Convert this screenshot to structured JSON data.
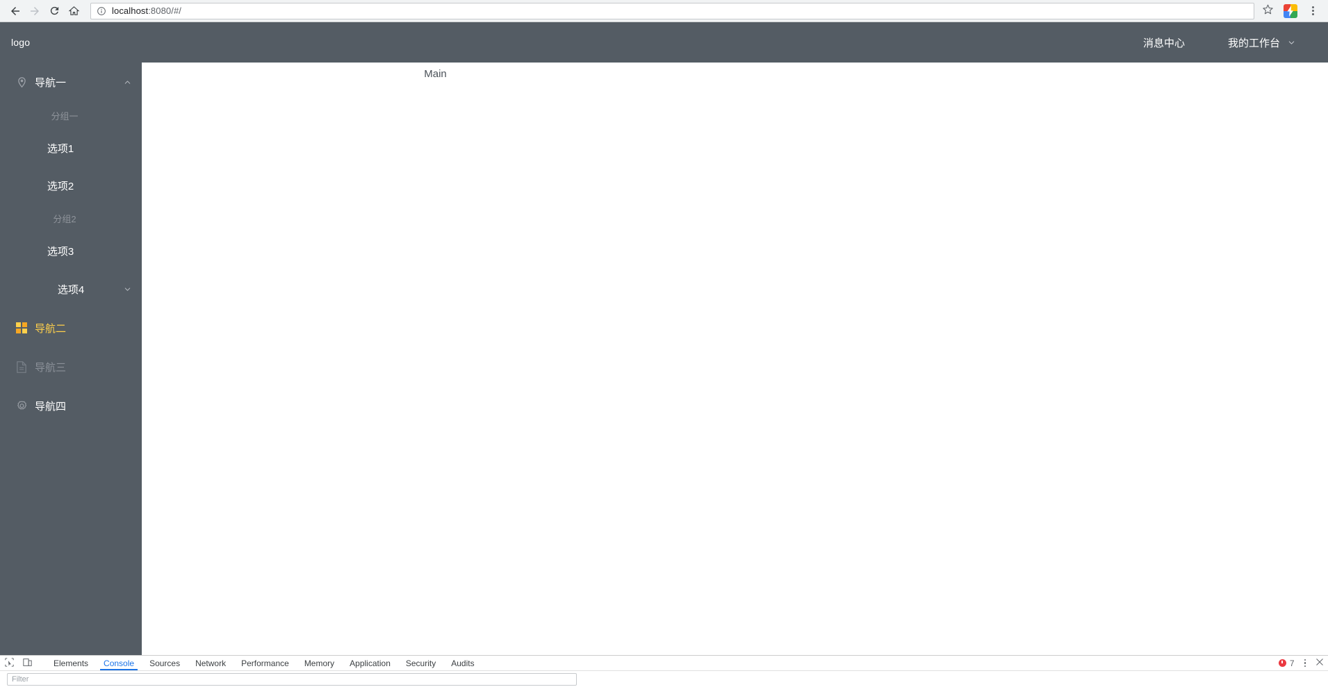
{
  "browser": {
    "back_icon": "back-arrow-icon",
    "forward_icon": "forward-arrow-icon",
    "reload_icon": "reload-icon",
    "home_icon": "home-icon",
    "info_icon": "page-info-icon",
    "url_host": "localhost",
    "url_rest": ":8080/#/",
    "url_full": "localhost:8080/#/",
    "star_icon": "bookmark-star-icon",
    "extension_icon": "extension-icon",
    "menu_icon": "browser-menu-icon"
  },
  "header": {
    "logo": "logo",
    "items": [
      {
        "label": "消息中心",
        "has_chevron": false
      },
      {
        "label": "我的工作台",
        "has_chevron": true
      }
    ]
  },
  "sidebar": {
    "bg_color": "#545c64",
    "active_color": "#ffd04b",
    "disabled_color": "#8b9199",
    "items": [
      {
        "label": "导航一",
        "icon": "location-pin-icon",
        "arrow": "chevron-up-icon",
        "state": "expanded",
        "groups": [
          {
            "title": "分组一",
            "children": [
              {
                "label": "选项1"
              },
              {
                "label": "选项2"
              }
            ]
          },
          {
            "title": "分组2",
            "children": [
              {
                "label": "选项3"
              }
            ]
          }
        ],
        "submenu": {
          "label": "选项4",
          "arrow": "chevron-down-icon"
        }
      },
      {
        "label": "导航二",
        "icon": "grid-squares-icon",
        "state": "active"
      },
      {
        "label": "导航三",
        "icon": "document-icon",
        "state": "disabled"
      },
      {
        "label": "导航四",
        "icon": "gear-icon",
        "state": "normal"
      }
    ]
  },
  "main": {
    "text": "Main"
  },
  "devtools": {
    "inspect_icon": "inspect-element-icon",
    "device_icon": "device-toolbar-icon",
    "tabs": [
      {
        "label": "Elements",
        "active": false
      },
      {
        "label": "Console",
        "active": true
      },
      {
        "label": "Sources",
        "active": false
      },
      {
        "label": "Network",
        "active": false
      },
      {
        "label": "Performance",
        "active": false
      },
      {
        "label": "Memory",
        "active": false
      },
      {
        "label": "Application",
        "active": false
      },
      {
        "label": "Security",
        "active": false
      },
      {
        "label": "Audits",
        "active": false
      }
    ],
    "error_count": "7",
    "more_icon": "devtools-more-icon",
    "close_icon": "devtools-close-icon",
    "filter_placeholder": "Filter"
  }
}
